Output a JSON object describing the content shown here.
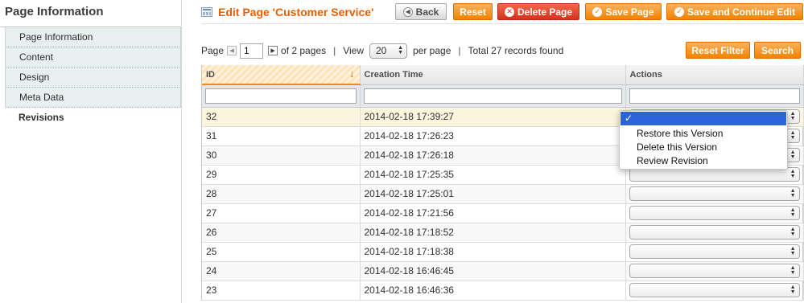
{
  "sidebar": {
    "title": "Page Information",
    "tabs": [
      {
        "label": "Page Information"
      },
      {
        "label": "Content"
      },
      {
        "label": "Design"
      },
      {
        "label": "Meta Data"
      },
      {
        "label": "Revisions"
      }
    ]
  },
  "header": {
    "title": "Edit Page 'Customer Service'",
    "back_label": "Back",
    "reset_label": "Reset",
    "delete_label": "Delete Page",
    "save_label": "Save Page",
    "save_continue_label": "Save and Continue Edit"
  },
  "pager": {
    "page_label": "Page",
    "page_value": "1",
    "of_pages": "of 2 pages",
    "view_label": "View",
    "per_page_value": "20",
    "per_page_label": "per page",
    "total": "Total 27 records found",
    "reset_filter_label": "Reset Filter",
    "search_label": "Search",
    "separator": "|"
  },
  "grid": {
    "columns": [
      "ID",
      "Creation Time",
      "Actions"
    ],
    "rows": [
      {
        "id": "32",
        "time": "2014-02-18 17:39:27"
      },
      {
        "id": "31",
        "time": "2014-02-18 17:26:23"
      },
      {
        "id": "30",
        "time": "2014-02-18 17:26:18"
      },
      {
        "id": "29",
        "time": "2014-02-18 17:25:35"
      },
      {
        "id": "28",
        "time": "2014-02-18 17:25:01"
      },
      {
        "id": "27",
        "time": "2014-02-18 17:21:56"
      },
      {
        "id": "26",
        "time": "2014-02-18 17:18:52"
      },
      {
        "id": "25",
        "time": "2014-02-18 17:18:38"
      },
      {
        "id": "24",
        "time": "2014-02-18 16:46:45"
      },
      {
        "id": "23",
        "time": "2014-02-18 16:46:36"
      }
    ]
  },
  "actions_dropdown": {
    "selected_mark": "✓",
    "options": [
      "Restore this Version",
      "Delete this Version",
      "Review Revision"
    ]
  },
  "colors": {
    "accent_orange": "#eb5e00",
    "button_orange": "#f18200",
    "button_red": "#d8321a",
    "selected_blue": "#2b63d8"
  }
}
